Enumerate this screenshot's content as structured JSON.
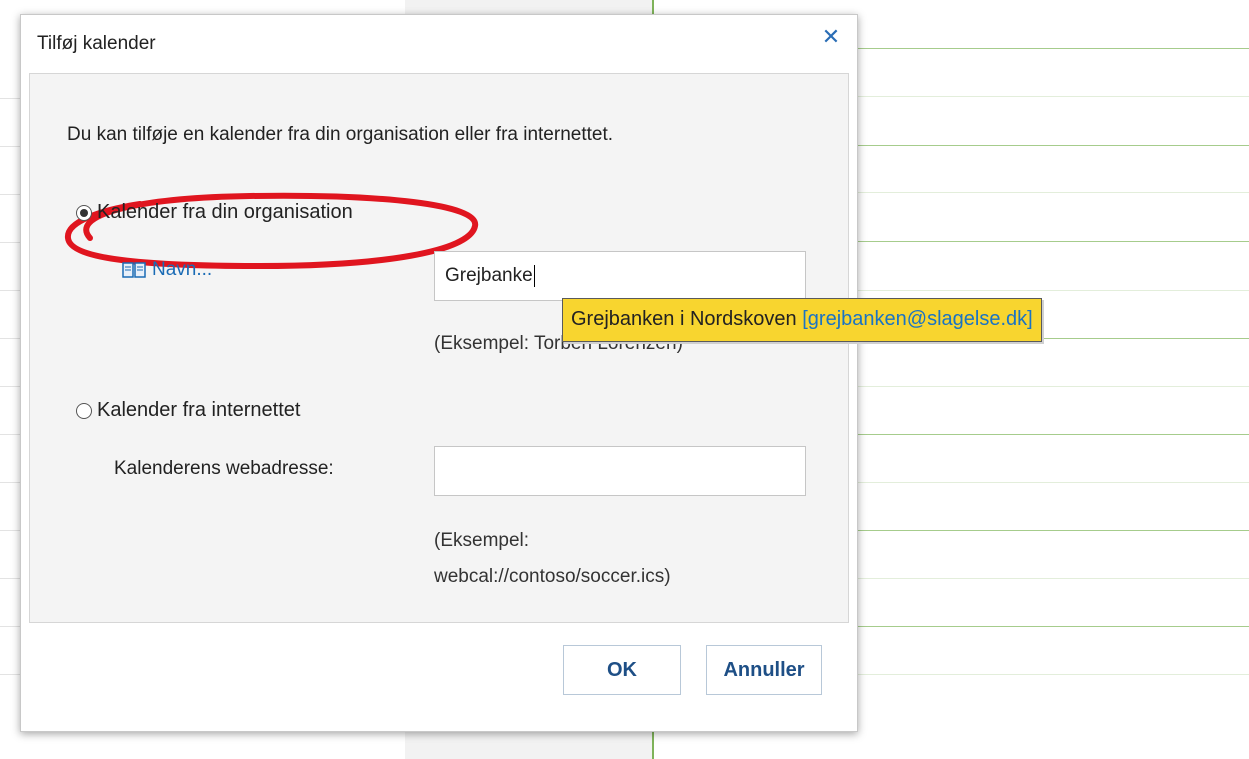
{
  "dialog": {
    "title": "Tilføj kalender",
    "close_icon": "close-icon",
    "intro": "Du kan tilføje en kalender fra din organisation eller fra internettet."
  },
  "organization": {
    "radio_label": "Kalender fra din organisation",
    "selected": true,
    "address_book_label": "Navn...",
    "address_book_icon": "address-book-icon",
    "name_value": "Grejbanke",
    "example": "(Eksempel: Torben Lorenzen)"
  },
  "suggestion": {
    "name": "Grejbanken i Nordskoven",
    "email": "[grejbanken@slagelse.dk]"
  },
  "internet": {
    "radio_label": "Kalender fra internettet",
    "selected": false,
    "url_label": "Kalenderens webadresse:",
    "url_value": "",
    "example_line1": "(Eksempel:",
    "example_line2": "webcal://contoso/soccer.ics)"
  },
  "footer": {
    "ok_label": "OK",
    "cancel_label": "Annuller"
  },
  "colors": {
    "highlight_ellipse": "#e0151f",
    "suggestion_bg": "#f8d52f",
    "link": "#1a6bb5"
  }
}
